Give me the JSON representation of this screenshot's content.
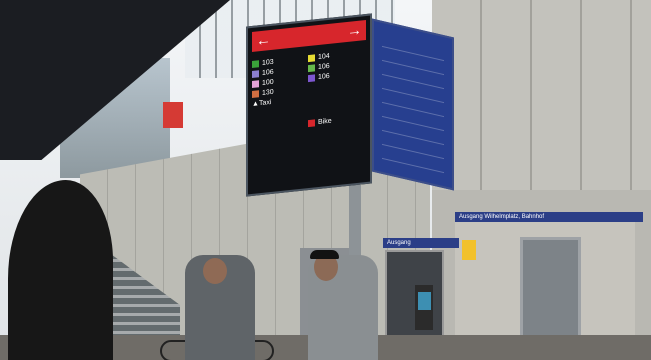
{
  "sign": {
    "header_left_arrow": "←",
    "header_right_arrow": "→",
    "routes_left": [
      {
        "number": "103",
        "color": "#3aa23a"
      },
      {
        "number": "106",
        "color": "#8b7fd0"
      },
      {
        "number": "100",
        "color": "#e3a2d8"
      },
      {
        "number": "130",
        "color": "#d06e42"
      }
    ],
    "routes_right": [
      {
        "number": "104",
        "color": "#e6dc33"
      },
      {
        "number": "106",
        "color": "#66b84b"
      },
      {
        "number": "106",
        "color": "#7d57d0"
      }
    ],
    "taxi_label": "Taxi",
    "bike_label": "Bike"
  },
  "labels": {
    "platform_sign_right": "Ausgang Wilhelmplatz, Bahnhof",
    "platform_sign_mid": "Ausgang"
  }
}
